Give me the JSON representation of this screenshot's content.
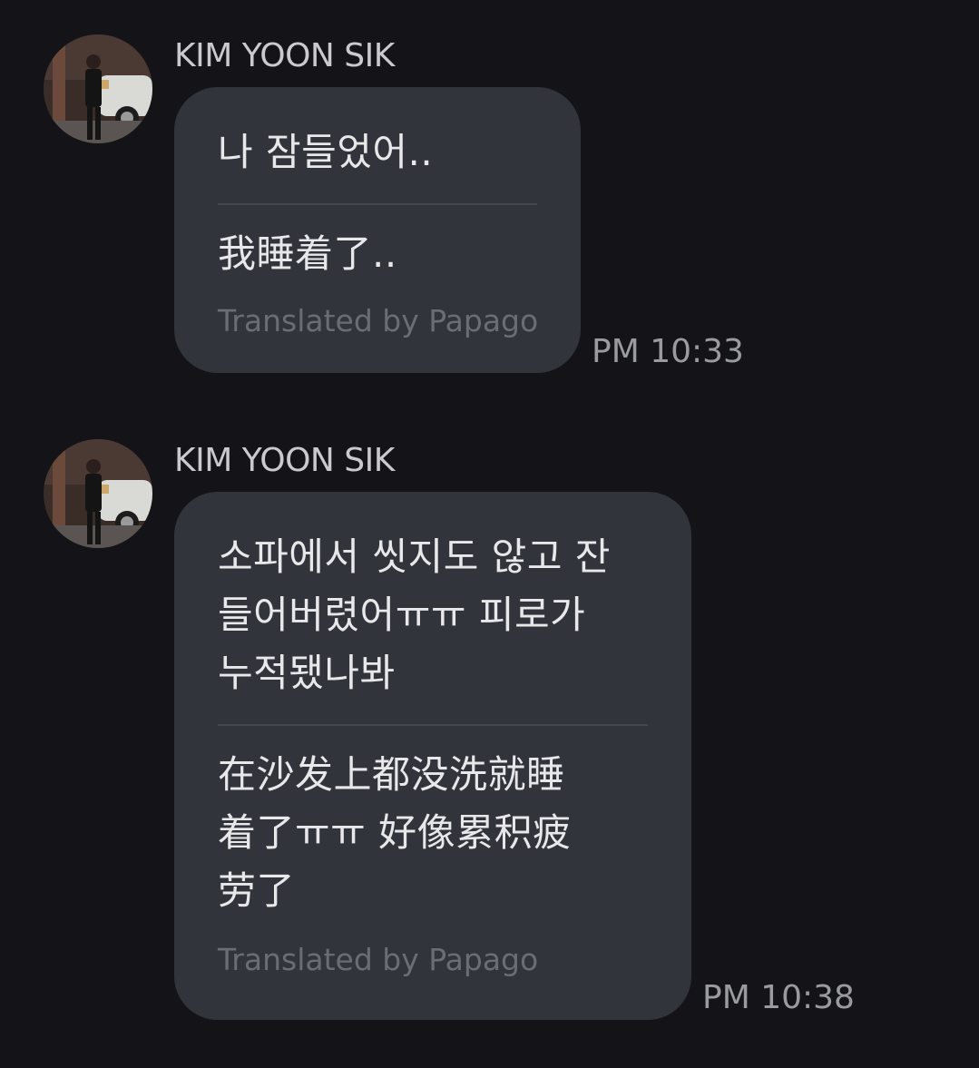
{
  "messages": [
    {
      "sender": "KIM YOON SIK",
      "original": "나 잠들었어..",
      "translated": "我睡着了..",
      "credit": "Translated by Papago",
      "time": "PM 10:33"
    },
    {
      "sender": "KIM YOON SIK",
      "original": "소파에서 씻지도 않고 잔\n들어버렸어ㅠㅠ 피로가\n누적됐나봐",
      "translated": "在沙发上都没洗就睡\n着了ㅠㅠ 好像累积疲\n劳了",
      "credit": "Translated by Papago",
      "time": "PM 10:38"
    }
  ],
  "colors": {
    "background": "#141418",
    "bubble": "#32343b",
    "text": "#e8e8ea",
    "credit": "#6b6d74",
    "time": "#9a9ba1"
  }
}
